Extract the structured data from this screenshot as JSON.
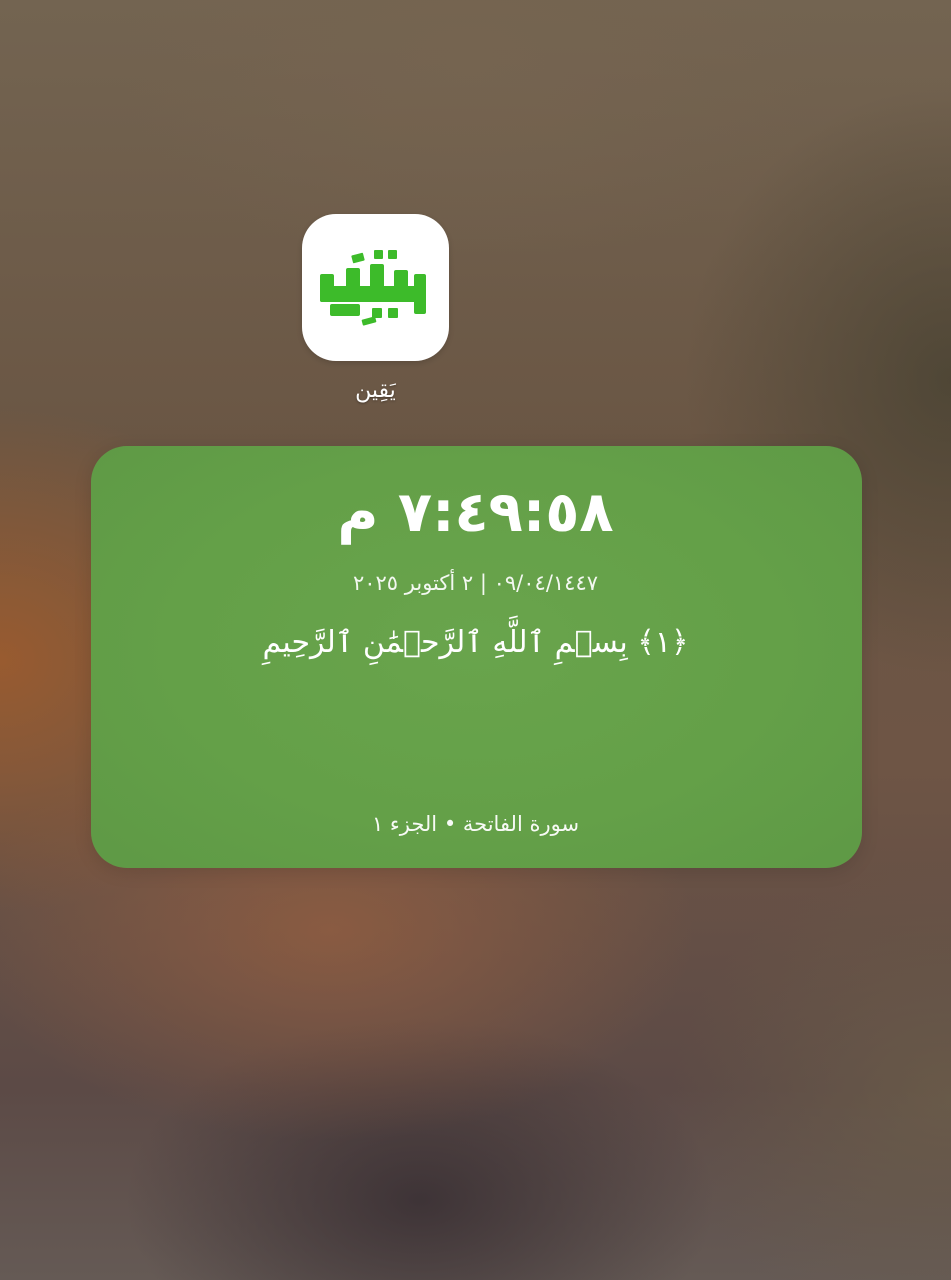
{
  "app": {
    "label": "يَقِين",
    "logo_text": "يَقِين",
    "icon": "yaqeen-logo-icon",
    "logo_color": "#3dbb2a"
  },
  "widget": {
    "time": "٧:٤٩:٥٨ م",
    "date": "٠٩/٠٤/١٤٤٧ | ٢ أكتوبر ٢٠٢٥",
    "verse": "﴿١﴾ بِسۡمِ ٱللَّهِ ٱلرَّحۡمَٰنِ ٱلرَّحِيمِ",
    "footer": "سورة الفاتحة • الجزء ١",
    "background_color": "#64a048"
  }
}
